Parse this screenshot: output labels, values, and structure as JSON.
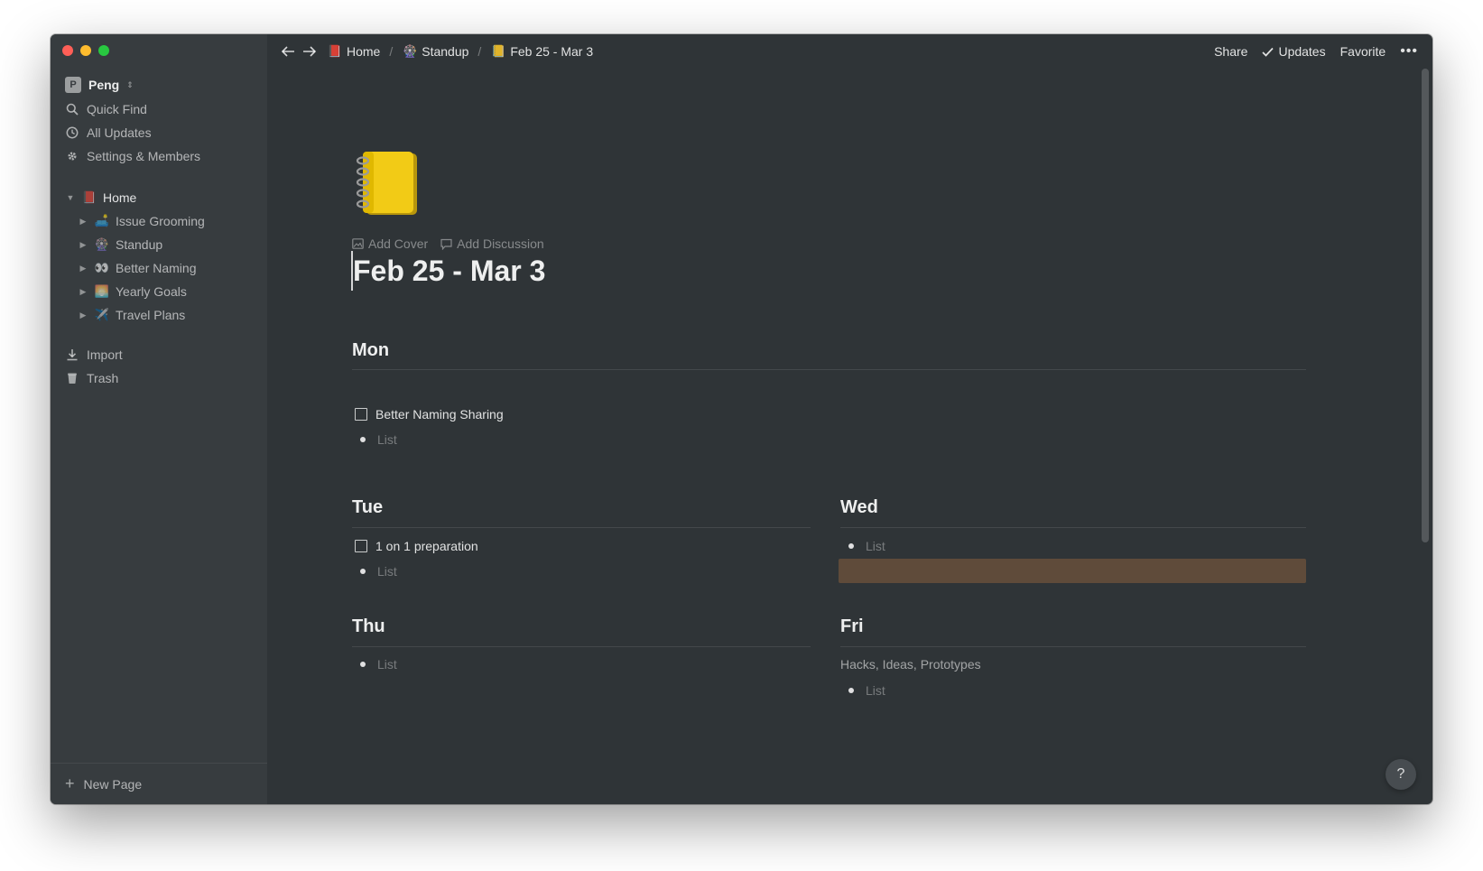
{
  "sidebar": {
    "workspace_initial": "P",
    "workspace_name": "Peng",
    "items": [
      {
        "label": "Quick Find",
        "icon": "search-icon"
      },
      {
        "label": "All Updates",
        "icon": "clock-icon"
      },
      {
        "label": "Settings & Members",
        "icon": "gear-icon"
      }
    ],
    "tree_root": {
      "label": "Home",
      "emoji": "📕"
    },
    "tree_children": [
      {
        "label": "Issue Grooming",
        "emoji": "🛋️"
      },
      {
        "label": "Standup",
        "emoji": "🎡"
      },
      {
        "label": "Better Naming",
        "emoji": "👀"
      },
      {
        "label": "Yearly Goals",
        "emoji": "🌅"
      },
      {
        "label": "Travel Plans",
        "emoji": "✈️"
      }
    ],
    "bottom_items": [
      {
        "label": "Import",
        "icon": "download-icon"
      },
      {
        "label": "Trash",
        "icon": "trash-icon"
      }
    ],
    "new_page": "New Page"
  },
  "topbar": {
    "breadcrumbs": [
      {
        "label": "Home",
        "emoji": "📕"
      },
      {
        "label": "Standup",
        "emoji": "🎡"
      },
      {
        "label": "Feb 25 - Mar 3",
        "emoji": "📒"
      }
    ],
    "separator": "/",
    "share": "Share",
    "updates": "Updates",
    "favorite": "Favorite",
    "more": "•••"
  },
  "page": {
    "icon": "notebook-icon",
    "add_cover": "Add Cover",
    "add_discussion": "Add Discussion",
    "title": "Feb 25 - Mar 3",
    "mon": {
      "heading": "Mon",
      "todo": "Better Naming Sharing",
      "list": "List"
    },
    "tue": {
      "heading": "Tue",
      "todo": "1 on 1 preparation",
      "list": "List"
    },
    "wed": {
      "heading": "Wed",
      "list": "List"
    },
    "thu": {
      "heading": "Thu",
      "list": "List"
    },
    "fri": {
      "heading": "Fri",
      "note": "Hacks, Ideas, Prototypes",
      "list": "List"
    },
    "help": "?"
  },
  "colors": {
    "background": "#2f3437",
    "sidebar": "#373c3f",
    "highlight": "#5f4b3a"
  }
}
